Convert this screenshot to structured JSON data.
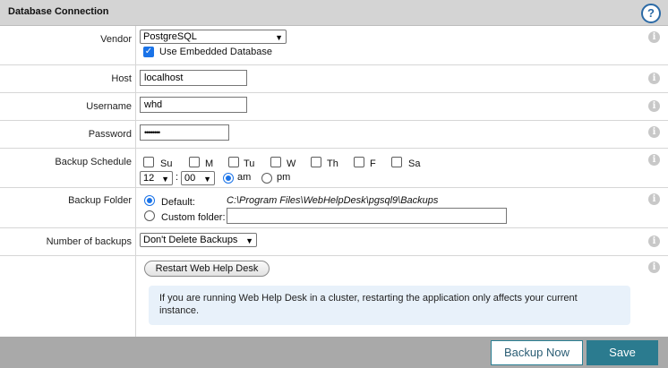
{
  "header": {
    "title": "Database Connection",
    "help_icon": "help-icon"
  },
  "vendor": {
    "label": "Vendor",
    "value": "PostgreSQL",
    "embedded_label": "Use Embedded Database",
    "embedded_checked": true
  },
  "host": {
    "label": "Host",
    "value": "localhost"
  },
  "username": {
    "label": "Username",
    "value": "whd"
  },
  "password": {
    "label": "Password",
    "value": "••••••••"
  },
  "schedule": {
    "label": "Backup Schedule",
    "days": [
      "Su",
      "M",
      "Tu",
      "W",
      "Th",
      "F",
      "Sa"
    ],
    "hour": "12",
    "colon": ":",
    "minute": "00",
    "am": "am",
    "pm": "pm",
    "selected_period": "am"
  },
  "folder": {
    "label": "Backup Folder",
    "default_label": "Default:",
    "default_path": "C:\\Program Files\\WebHelpDesk\\pgsql9\\Backups",
    "custom_label": "Custom folder:",
    "custom_value": ""
  },
  "backups": {
    "label": "Number of backups",
    "value": "Don't Delete Backups"
  },
  "restart": {
    "button_label": "Restart Web Help Desk",
    "info_line1": "If you are running Web Help Desk in a cluster, restarting the application only affects your current",
    "info_line2": "instance."
  },
  "footer": {
    "backup_now": "Backup Now",
    "save": "Save"
  },
  "colors": {
    "accent": "#2b7b8f",
    "header_bg": "#d4d4d4",
    "footer_bg": "#a9a9a9",
    "info_bg": "#e8f1fa"
  }
}
